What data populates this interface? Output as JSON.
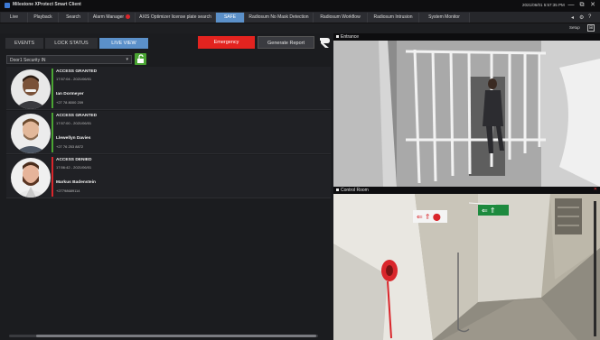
{
  "window": {
    "title": "Milestone XProtect Smart Client",
    "clock": "2021/06/01 5:57:35 PM",
    "controls": [
      "—",
      "⧉",
      "✕"
    ]
  },
  "tabs": [
    {
      "label": "Live"
    },
    {
      "label": "Playback"
    },
    {
      "label": "Search"
    },
    {
      "label": "Alarm Manager",
      "alarm": true
    },
    {
      "label": "AXIS Optimizer license plate search"
    },
    {
      "label": "SAFE",
      "active": true
    },
    {
      "label": "Radiosum No Mask Detection"
    },
    {
      "label": "Radiosum Workflow"
    },
    {
      "label": "Radiosum Intrusion"
    },
    {
      "label": "System Monitor"
    }
  ],
  "setup": {
    "label": "Setup"
  },
  "panel": {
    "subtabs": [
      "EVENTS",
      "LOCK STATUS",
      "LIVE VIEW"
    ],
    "active_subtab": "LIVE VIEW",
    "emergency_label": "Emergency",
    "report_label": "Generate Report",
    "door_select": {
      "value": "Door1 Security IN"
    },
    "events": [
      {
        "status": "ACCESS GRANTED",
        "time": "17:57:04 - 2021/06/01",
        "name": "Ian Dormeyer",
        "phone": "+27 78 8000 209",
        "color": "#4aa433"
      },
      {
        "status": "ACCESS GRANTED",
        "time": "17:57:00 - 2021/06/01",
        "name": "Llewellyn Davies",
        "phone": "+27 76 253 8872",
        "color": "#4aa433"
      },
      {
        "status": "ACCESS DENIED",
        "time": "17:56:42 - 2021/06/01",
        "name": "Markus Badenstein",
        "phone": "+27798689114",
        "color": "#d9262b"
      }
    ]
  },
  "cameras": [
    {
      "title": "Entrance"
    },
    {
      "title": "Control Room"
    }
  ],
  "colors": {
    "accent": "#5b90c9",
    "emergency": "#e3231f",
    "granted": "#4aa433",
    "denied": "#d9262b"
  }
}
